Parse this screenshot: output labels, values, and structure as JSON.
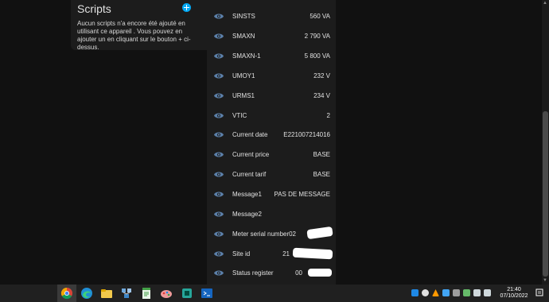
{
  "scripts": {
    "title": "Scripts",
    "description": "Aucun scripts n'a encore été ajouté en utilisant ce appareil . Vous pouvez en ajouter un en cliquant sur le bouton + ci-dessus."
  },
  "entities": [
    {
      "name": "SINSTS",
      "value": "560 VA"
    },
    {
      "name": "SMAXN",
      "value": "2 790 VA"
    },
    {
      "name": "SMAXN-1",
      "value": "5 800 VA"
    },
    {
      "name": "UMOY1",
      "value": "232 V"
    },
    {
      "name": "URMS1",
      "value": "234 V"
    },
    {
      "name": "VTIC",
      "value": "2"
    },
    {
      "name": "Current date",
      "value": "E221007214016"
    },
    {
      "name": "Current price",
      "value": "BASE"
    },
    {
      "name": "Current tarif",
      "value": "BASE"
    },
    {
      "name": "Message1",
      "value": "PAS DE MESSAGE"
    },
    {
      "name": "Message2",
      "value": ""
    },
    {
      "name": "Meter serial number",
      "value": "02"
    },
    {
      "name": "Site id",
      "value": "21"
    },
    {
      "name": "Status register",
      "value": "00"
    }
  ],
  "taskbar": {
    "apps": [
      "chrome-icon",
      "edge-icon",
      "file-explorer-icon",
      "network-app-icon",
      "notepad-icon",
      "paint-icon",
      "app-icon",
      "terminal-icon"
    ]
  },
  "clock": {
    "time": "21:40",
    "date": "07/10/2022"
  },
  "colors": {
    "background": "#111111",
    "card": "#1c1c1c",
    "accent": "#03a9f4",
    "eye": "#5b7fa8",
    "taskbar": "#202020"
  }
}
